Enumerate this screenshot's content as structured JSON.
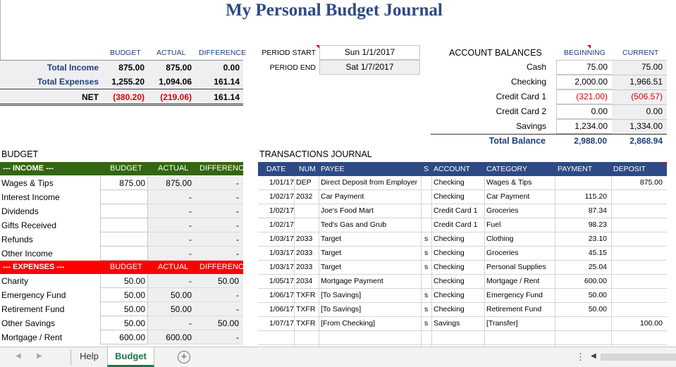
{
  "title": "My Personal Budget Journal",
  "summary": {
    "headers": [
      "BUDGET",
      "ACTUAL",
      "DIFFERENCE"
    ],
    "rows": [
      {
        "label": "Total Income",
        "budget": "875.00",
        "actual": "875.00",
        "difference": "0.00"
      },
      {
        "label": "Total Expenses",
        "budget": "1,255.20",
        "actual": "1,094.06",
        "difference": "161.14"
      },
      {
        "label": "NET",
        "budget": "(380.20)",
        "actual": "(219.06)",
        "difference": "161.14"
      }
    ]
  },
  "period": {
    "start_label": "PERIOD START",
    "start_value": "Sun 1/1/2017",
    "end_label": "PERIOD END",
    "end_value": "Sat 1/7/2017"
  },
  "accounts": {
    "title": "ACCOUNT BALANCES",
    "col_beginning": "BEGINNING",
    "col_current": "CURRENT",
    "rows": [
      {
        "name": "Cash",
        "beginning": "75.00",
        "current": "75.00"
      },
      {
        "name": "Checking",
        "beginning": "2,000.00",
        "current": "1,966.51"
      },
      {
        "name": "Credit Card 1",
        "beginning": "(321.00)",
        "current": "(506.57)"
      },
      {
        "name": "Credit Card 2",
        "beginning": "0.00",
        "current": "0.00"
      },
      {
        "name": "Savings",
        "beginning": "1,234.00",
        "current": "1,334.00"
      }
    ],
    "total_label": "Total Balance",
    "total_beginning": "2,988.00",
    "total_current": "2,868.94"
  },
  "budget": {
    "title": "BUDGET",
    "income_label": "--- INCOME ---",
    "expenses_label": "--- EXPENSES ---",
    "col_budget": "BUDGET",
    "col_actual": "ACTUAL",
    "col_difference": "DIFFERENCE",
    "income": [
      {
        "name": "Wages & Tips",
        "budget": "875.00",
        "actual": "875.00",
        "difference": "-"
      },
      {
        "name": "Interest Income",
        "budget": "",
        "actual": "-",
        "difference": "-"
      },
      {
        "name": "Dividends",
        "budget": "",
        "actual": "-",
        "difference": "-"
      },
      {
        "name": "Gifts Received",
        "budget": "",
        "actual": "-",
        "difference": "-"
      },
      {
        "name": "Refunds",
        "budget": "",
        "actual": "-",
        "difference": "-"
      },
      {
        "name": "Other Income",
        "budget": "",
        "actual": "-",
        "difference": "-"
      }
    ],
    "expenses": [
      {
        "name": "Charity",
        "budget": "50.00",
        "actual": "-",
        "difference": "50.00"
      },
      {
        "name": "Emergency Fund",
        "budget": "50.00",
        "actual": "50.00",
        "difference": "-"
      },
      {
        "name": "Retirement Fund",
        "budget": "50.00",
        "actual": "50.00",
        "difference": "-"
      },
      {
        "name": "Other Savings",
        "budget": "50.00",
        "actual": "-",
        "difference": "50.00"
      },
      {
        "name": "Mortgage / Rent",
        "budget": "600.00",
        "actual": "600.00",
        "difference": "-"
      }
    ]
  },
  "journal": {
    "title": "TRANSACTIONS JOURNAL",
    "headers": {
      "date": "DATE",
      "num": "NUM",
      "payee": "PAYEE",
      "s": "S",
      "account": "ACCOUNT",
      "category": "CATEGORY",
      "payment": "PAYMENT",
      "deposit": "DEPOSIT"
    },
    "rows": [
      {
        "date": "1/01/17",
        "num": "DEP",
        "payee": "Direct Deposit from Employer",
        "s": "",
        "account": "Checking",
        "category": "Wages & Tips",
        "payment": "",
        "deposit": "875.00"
      },
      {
        "date": "1/02/17",
        "num": "2032",
        "payee": "Car Payment",
        "s": "",
        "account": "Checking",
        "category": "Car Payment",
        "payment": "115.20",
        "deposit": ""
      },
      {
        "date": "1/02/17",
        "num": "",
        "payee": "Joe's Food Mart",
        "s": "",
        "account": "Credit Card 1",
        "category": "Groceries",
        "payment": "87.34",
        "deposit": ""
      },
      {
        "date": "1/02/17",
        "num": "",
        "payee": "Ted's Gas and Grub",
        "s": "",
        "account": "Credit Card 1",
        "category": "Fuel",
        "payment": "98.23",
        "deposit": ""
      },
      {
        "date": "1/03/17",
        "num": "2033",
        "payee": "Target",
        "s": "s",
        "account": "Checking",
        "category": "Clothing",
        "payment": "23.10",
        "deposit": ""
      },
      {
        "date": "1/03/17",
        "num": "2033",
        "payee": "Target",
        "s": "s",
        "account": "Checking",
        "category": "Groceries",
        "payment": "45.15",
        "deposit": ""
      },
      {
        "date": "1/03/17",
        "num": "2033",
        "payee": "Target",
        "s": "s",
        "account": "Checking",
        "category": "Personal Supplies",
        "payment": "25.04",
        "deposit": ""
      },
      {
        "date": "1/05/17",
        "num": "2034",
        "payee": "Mortgage Payment",
        "s": "",
        "account": "Checking",
        "category": "Mortgage / Rent",
        "payment": "600.00",
        "deposit": ""
      },
      {
        "date": "1/06/17",
        "num": "TXFR",
        "payee": "[To Savings]",
        "s": "s",
        "account": "Checking",
        "category": "Emergency Fund",
        "payment": "50.00",
        "deposit": ""
      },
      {
        "date": "1/06/17",
        "num": "TXFR",
        "payee": "[To Savings]",
        "s": "s",
        "account": "Checking",
        "category": "Retirement Fund",
        "payment": "50.00",
        "deposit": ""
      },
      {
        "date": "1/07/17",
        "num": "TXFR",
        "payee": "[From Checking]",
        "s": "s",
        "account": "Savings",
        "category": "[Transfer]",
        "payment": "",
        "deposit": "100.00"
      },
      {
        "date": "",
        "num": "",
        "payee": "",
        "s": "",
        "account": "",
        "category": "",
        "payment": "",
        "deposit": ""
      }
    ]
  },
  "tabs": [
    {
      "label": "Help",
      "active": false
    },
    {
      "label": "Budget",
      "active": true
    }
  ],
  "colors": {
    "navy": "#2e4a86",
    "income_green": "#336611",
    "expenses_red": "#ff0000",
    "negative": "#e00000",
    "active_tab": "#217346"
  }
}
